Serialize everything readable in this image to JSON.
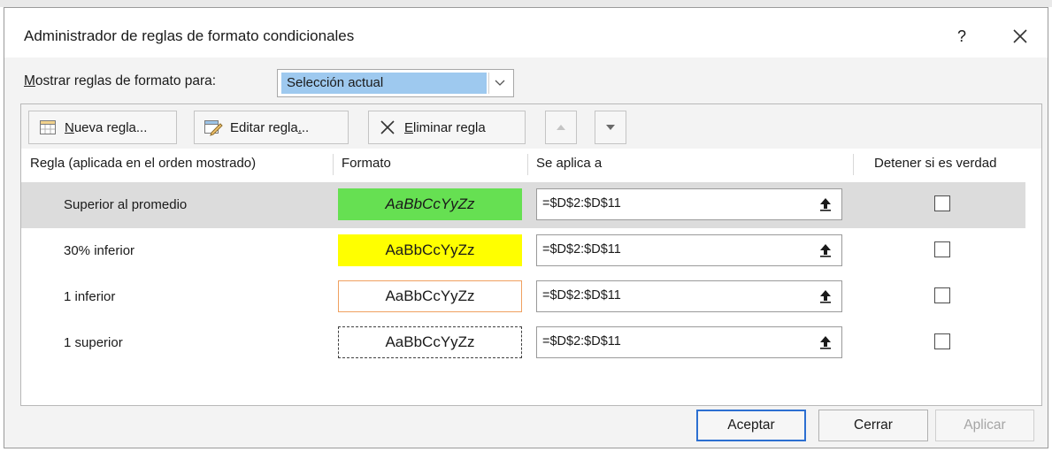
{
  "dialog": {
    "title": "Administrador de reglas de formato condicionales",
    "help_label": "?",
    "show_rules_for_prefix": "M",
    "show_rules_for_rest": "ostrar reglas de formato para:",
    "scope_value": "Selección actual"
  },
  "toolbar": {
    "new_rule_mnemonic": "N",
    "new_rule_rest": "ueva regla...",
    "edit_rule_prefix": "Editar regla",
    "edit_rule_mnemonic": ".",
    "edit_rule_suffix": "..",
    "delete_rule_mnemonic": "E",
    "delete_rule_rest": "liminar regla"
  },
  "table": {
    "columns": [
      "Regla (aplicada en el orden mostrado)",
      "Formato",
      "Se aplica a",
      "Detener si es verdad"
    ],
    "rows": [
      {
        "rule": "Superior al promedio",
        "preview": "AaBbCcYyZz",
        "applies_to": "=$D$2:$D$11",
        "stop_if_true": false,
        "selected": true
      },
      {
        "rule": "30% inferior",
        "preview": "AaBbCcYyZz",
        "applies_to": "=$D$2:$D$11",
        "stop_if_true": false,
        "selected": false
      },
      {
        "rule": "1 inferior",
        "preview": "AaBbCcYyZz",
        "applies_to": "=$D$2:$D$11",
        "stop_if_true": false,
        "selected": false
      },
      {
        "rule": "1 superior",
        "preview": "AaBbCcYyZz",
        "applies_to": "=$D$2:$D$11",
        "stop_if_true": false,
        "selected": false
      }
    ]
  },
  "buttons": {
    "ok": "Aceptar",
    "close": "Cerrar",
    "apply": "Aplicar"
  },
  "colors": {
    "green_fill": "#66e052",
    "yellow_fill": "#ffff00",
    "orange_border": "#f0a060",
    "selection": "#9ec9ef",
    "primary_border": "#2c6fd1"
  }
}
